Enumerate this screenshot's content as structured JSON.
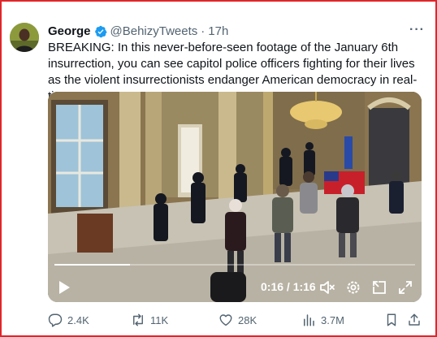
{
  "tweet": {
    "author_name": "George",
    "handle": "@BehizyTweets",
    "separator": "·",
    "time": "17h",
    "more_label": "···",
    "text": "BREAKING: In this never-before-seen footage of the January 6th insurrection, you can see capitol police officers fighting for their lives as the violent insurrectionists endanger American democracy in real-time"
  },
  "video": {
    "time_readout": "0:16 / 1:16",
    "progress": 0.21,
    "icons": [
      "play-icon",
      "mute-icon",
      "settings-icon",
      "pip-icon",
      "fullscreen-icon"
    ]
  },
  "actions": {
    "replies": "2.4K",
    "reposts": "11K",
    "likes": "28K",
    "views": "3.7M"
  },
  "colors": {
    "frame_border": "#e0262a",
    "verified": "#1d9bf0",
    "secondary_text": "#536471"
  }
}
